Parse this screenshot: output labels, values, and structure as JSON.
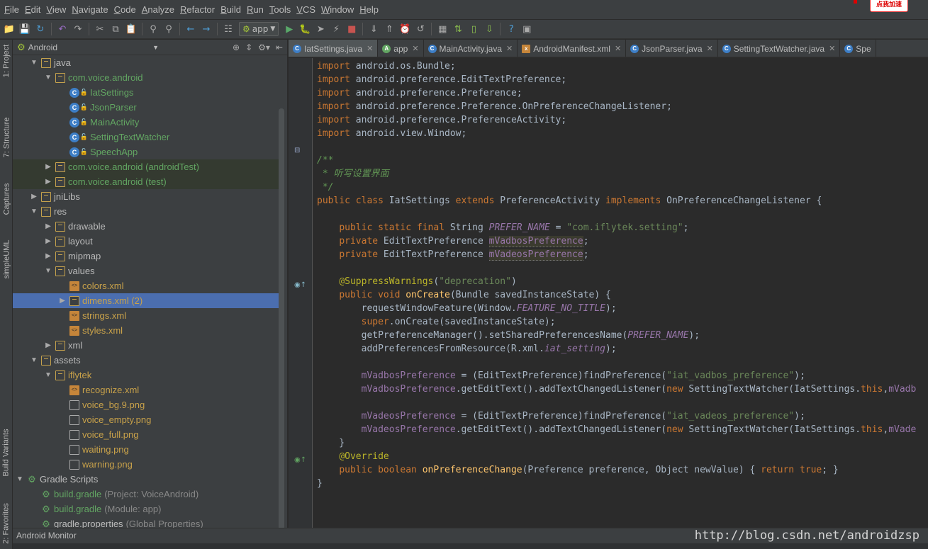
{
  "menu": [
    "File",
    "Edit",
    "View",
    "Navigate",
    "Code",
    "Analyze",
    "Refactor",
    "Build",
    "Run",
    "Tools",
    "VCS",
    "Window",
    "Help"
  ],
  "promo_badge": "点我加速",
  "toolbar": {
    "run_config": "app",
    "icons": [
      "open-icon",
      "save-icon",
      "sync-icon",
      "undo-icon",
      "redo-icon",
      "cut-icon",
      "copy-icon",
      "paste-icon",
      "find-icon",
      "replace-icon",
      "back-icon",
      "forward-icon",
      "make-icon",
      "run-icon",
      "debug-icon",
      "attach-icon",
      "apply-changes-icon",
      "stop-icon",
      "vcs-update-icon",
      "vcs-commit-icon",
      "history-icon",
      "revert-icon",
      "project-structure-icon",
      "gradle-sync-icon",
      "avd-icon",
      "sdk-icon",
      "help-icon",
      "device-monitor-icon"
    ]
  },
  "left_stripe": {
    "tabs": [
      "1: Project",
      "7: Structure",
      "Captures",
      "simpleUML",
      "Build Variants",
      "2: Favorites"
    ]
  },
  "project_panel": {
    "view": "Android",
    "tree": [
      {
        "indent": 1,
        "arrow": "▼",
        "icon": "folder",
        "label": "java",
        "color": "",
        "hint": ""
      },
      {
        "indent": 2,
        "arrow": "▼",
        "icon": "folder",
        "label": "com.voice.android",
        "color": "green",
        "hint": ""
      },
      {
        "indent": 3,
        "arrow": "",
        "icon": "class",
        "label": "IatSettings",
        "color": "green",
        "hint": ""
      },
      {
        "indent": 3,
        "arrow": "",
        "icon": "class",
        "label": "JsonParser",
        "color": "green",
        "hint": ""
      },
      {
        "indent": 3,
        "arrow": "",
        "icon": "class",
        "label": "MainActivity",
        "color": "green",
        "hint": ""
      },
      {
        "indent": 3,
        "arrow": "",
        "icon": "class",
        "label": "SettingTextWatcher",
        "color": "green",
        "hint": ""
      },
      {
        "indent": 3,
        "arrow": "",
        "icon": "class",
        "label": "SpeechApp",
        "color": "green",
        "hint": ""
      },
      {
        "indent": 2,
        "arrow": "▶",
        "icon": "folder",
        "label": "com.voice.android (androidTest)",
        "color": "green",
        "hint": "",
        "shaded": true
      },
      {
        "indent": 2,
        "arrow": "▶",
        "icon": "folder",
        "label": "com.voice.android (test)",
        "color": "green",
        "hint": "",
        "shaded": true
      },
      {
        "indent": 1,
        "arrow": "▶",
        "icon": "folder",
        "label": "jniLibs",
        "color": "",
        "hint": ""
      },
      {
        "indent": 1,
        "arrow": "▼",
        "icon": "folder",
        "label": "res",
        "color": "",
        "hint": ""
      },
      {
        "indent": 2,
        "arrow": "▶",
        "icon": "folder",
        "label": "drawable",
        "color": "",
        "hint": ""
      },
      {
        "indent": 2,
        "arrow": "▶",
        "icon": "folder",
        "label": "layout",
        "color": "",
        "hint": ""
      },
      {
        "indent": 2,
        "arrow": "▶",
        "icon": "folder",
        "label": "mipmap",
        "color": "",
        "hint": ""
      },
      {
        "indent": 2,
        "arrow": "▼",
        "icon": "folder",
        "label": "values",
        "color": "",
        "hint": ""
      },
      {
        "indent": 3,
        "arrow": "",
        "icon": "xml",
        "label": "colors.xml",
        "color": "orange",
        "hint": ""
      },
      {
        "indent": 3,
        "arrow": "▶",
        "icon": "folder",
        "label": "dimens.xml (2)",
        "color": "orange",
        "hint": "",
        "selected": true
      },
      {
        "indent": 3,
        "arrow": "",
        "icon": "xml",
        "label": "strings.xml",
        "color": "orange",
        "hint": ""
      },
      {
        "indent": 3,
        "arrow": "",
        "icon": "xml",
        "label": "styles.xml",
        "color": "orange",
        "hint": ""
      },
      {
        "indent": 2,
        "arrow": "▶",
        "icon": "folder",
        "label": "xml",
        "color": "",
        "hint": ""
      },
      {
        "indent": 1,
        "arrow": "▼",
        "icon": "folder",
        "label": "assets",
        "color": "",
        "hint": ""
      },
      {
        "indent": 2,
        "arrow": "▼",
        "icon": "folder",
        "label": "iflytek",
        "color": "orange",
        "hint": ""
      },
      {
        "indent": 3,
        "arrow": "",
        "icon": "xml",
        "label": "recognize.xml",
        "color": "orange",
        "hint": ""
      },
      {
        "indent": 3,
        "arrow": "",
        "icon": "png",
        "label": "voice_bg.9.png",
        "color": "orange",
        "hint": ""
      },
      {
        "indent": 3,
        "arrow": "",
        "icon": "png",
        "label": "voice_empty.png",
        "color": "orange",
        "hint": ""
      },
      {
        "indent": 3,
        "arrow": "",
        "icon": "png",
        "label": "voice_full.png",
        "color": "orange",
        "hint": ""
      },
      {
        "indent": 3,
        "arrow": "",
        "icon": "png",
        "label": "waiting.png",
        "color": "orange",
        "hint": ""
      },
      {
        "indent": 3,
        "arrow": "",
        "icon": "png",
        "label": "warning.png",
        "color": "orange",
        "hint": ""
      },
      {
        "indent": 0,
        "arrow": "▼",
        "icon": "gradle",
        "label": "Gradle Scripts",
        "color": "",
        "hint": ""
      },
      {
        "indent": 1,
        "arrow": "",
        "icon": "gradle",
        "label": "build.gradle",
        "color": "green",
        "hint": "(Project: VoiceAndroid)"
      },
      {
        "indent": 1,
        "arrow": "",
        "icon": "gradle",
        "label": "build.gradle",
        "color": "green",
        "hint": "(Module: app)"
      },
      {
        "indent": 1,
        "arrow": "",
        "icon": "gradle",
        "label": "gradle.properties",
        "color": "",
        "hint": "(Global Properties)"
      }
    ]
  },
  "editor": {
    "tabs": [
      {
        "label": "IatSettings.java",
        "icon": "C",
        "kind": "class",
        "active": true,
        "closable": true
      },
      {
        "label": "app",
        "icon": "A",
        "kind": "app",
        "active": false,
        "closable": true
      },
      {
        "label": "MainActivity.java",
        "icon": "C",
        "kind": "class",
        "active": false,
        "closable": true
      },
      {
        "label": "AndroidManifest.xml",
        "icon": "x",
        "kind": "xml",
        "active": false,
        "closable": true
      },
      {
        "label": "JsonParser.java",
        "icon": "C",
        "kind": "class",
        "active": false,
        "closable": true
      },
      {
        "label": "SettingTextWatcher.java",
        "icon": "C",
        "kind": "class",
        "active": false,
        "closable": true
      },
      {
        "label": "Spe",
        "icon": "C",
        "kind": "class",
        "active": false,
        "closable": false
      }
    ],
    "lines": [
      {
        "row": 0,
        "html": "<span class='kw'>import</span> android.os.Bundle;"
      },
      {
        "row": 1,
        "html": "<span class='kw'>import</span> android.preference.EditTextPreference;"
      },
      {
        "row": 2,
        "html": "<span class='kw'>import</span> android.preference.Preference;"
      },
      {
        "row": 3,
        "html": "<span class='kw'>import</span> android.preference.Preference.OnPreferenceChangeListener;"
      },
      {
        "row": 4,
        "html": "<span class='kw'>import</span> android.preference.PreferenceActivity;"
      },
      {
        "row": 5,
        "html": "<span class='kw'>import</span> android.view.Window;"
      },
      {
        "row": 7,
        "html": "<span class='cmt'>/**</span>"
      },
      {
        "row": 8,
        "html": "<span class='cmt'> * 听写设置界面</span>"
      },
      {
        "row": 9,
        "html": "<span class='cmt'> */</span>"
      },
      {
        "row": 10,
        "html": "<span class='kw'>public class</span> IatSettings <span class='kw'>extends</span> PreferenceActivity <span class='kw'>implements</span> OnPreferenceChangeListener {"
      },
      {
        "row": 12,
        "html": "    <span class='kw'>public static final</span> String <span class='fldi'>PREFER_NAME</span> = <span class='str'>\"com.iflytek.setting\"</span>;"
      },
      {
        "row": 13,
        "html": "    <span class='kw'>private</span> EditTextPreference <span class='fld hl'>mVadbosPreference</span>;"
      },
      {
        "row": 14,
        "html": "    <span class='kw'>private</span> EditTextPreference <span class='fld hl'>mVadeosPreference</span>;"
      },
      {
        "row": 16,
        "html": "    <span class='ann'>@SuppressWarnings</span>(<span class='str'>\"deprecation\"</span>)"
      },
      {
        "row": 17,
        "html": "    <span class='kw'>public void</span> <span class='mth'>onCreate</span>(Bundle savedInstanceState) {"
      },
      {
        "row": 18,
        "html": "        requestWindowFeature(Window.<span class='fldi'>FEATURE_NO_TITLE</span>);"
      },
      {
        "row": 19,
        "html": "        <span class='kw'>super</span>.onCreate(savedInstanceState);"
      },
      {
        "row": 20,
        "html": "        getPreferenceManager().setSharedPreferencesName(<span class='fldi'>PREFER_NAME</span>);"
      },
      {
        "row": 21,
        "html": "        addPreferencesFromResource(R.xml.<span class='fldi'>iat_setting</span>);"
      },
      {
        "row": 23,
        "html": "        <span class='fld'>mVadbosPreference</span> = (EditTextPreference)findPreference(<span class='str'>\"iat_vadbos_preference\"</span>);"
      },
      {
        "row": 24,
        "html": "        <span class='fld'>mVadbosPreference</span>.getEditText().addTextChangedListener(<span class='kw'>new</span> SettingTextWatcher(IatSettings.<span class='kw'>this</span>,<span class='fld'>mVadb</span>"
      },
      {
        "row": 26,
        "html": "        <span class='fld'>mVadeosPreference</span> = (EditTextPreference)findPreference(<span class='str'>\"iat_vadeos_preference\"</span>);"
      },
      {
        "row": 27,
        "html": "        <span class='fld'>mVadeosPreference</span>.getEditText().addTextChangedListener(<span class='kw'>new</span> SettingTextWatcher(IatSettings.<span class='kw'>this</span>,<span class='fld'>mVade</span>"
      },
      {
        "row": 28,
        "html": "    }"
      },
      {
        "row": 29,
        "html": "    <span class='ann'>@Override</span>"
      },
      {
        "row": 30,
        "html": "    <span class='kw'>public boolean</span> <span class='mth'>onPreferenceChange</span>(Preference preference, Object newValue) { <span class='kw'>return true</span>; }"
      },
      {
        "row": 31,
        "html": "}"
      }
    ]
  },
  "bottom": {
    "monitor": "Android Monitor",
    "watermark": "http://blog.csdn.net/androidzsp"
  }
}
